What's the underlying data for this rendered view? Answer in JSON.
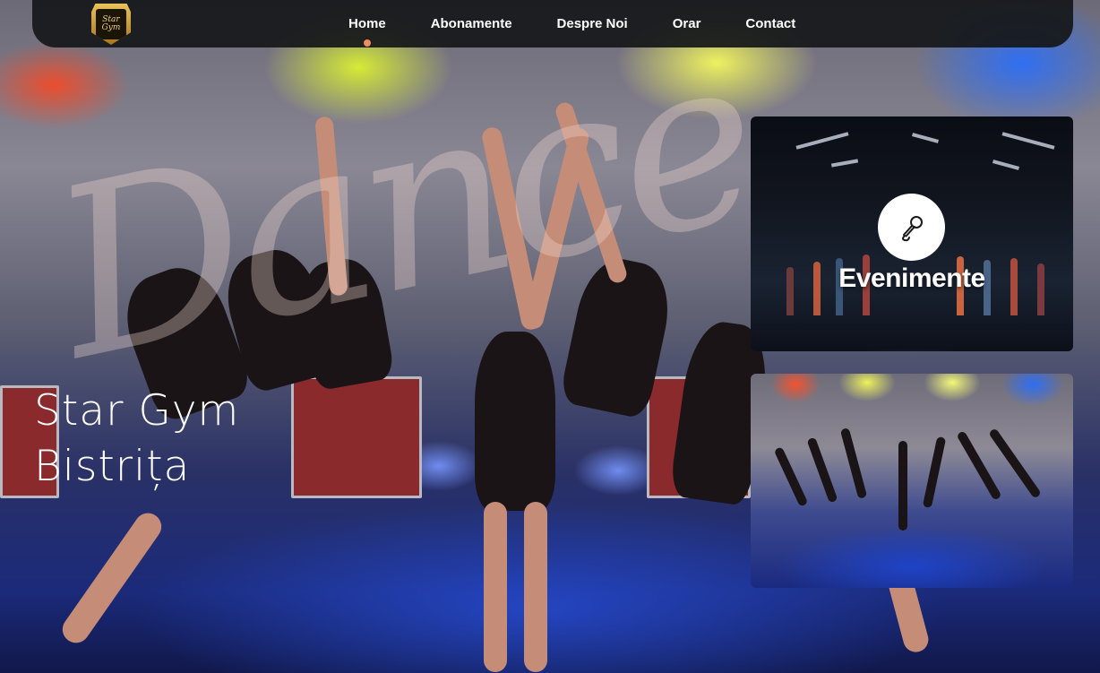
{
  "brand": {
    "logo_text_top": "Star",
    "logo_text_bottom": "Gym"
  },
  "nav": {
    "items": [
      {
        "label": "Home",
        "active": true
      },
      {
        "label": "Abonamente",
        "active": false
      },
      {
        "label": "Despre Noi",
        "active": false
      },
      {
        "label": "Orar",
        "active": false
      },
      {
        "label": "Contact",
        "active": false
      }
    ],
    "active_dot_color": "#f28a62"
  },
  "hero": {
    "watermark": "Dance",
    "title_line1": "Star Gym",
    "title_line2": "Bistrița"
  },
  "cards": {
    "events": {
      "label": "Evenimente",
      "icon": "microphone-icon"
    },
    "photo": {
      "description_icon": "dance-photo"
    }
  },
  "colors": {
    "nav_bg": "#16181a",
    "accent": "#f28a62",
    "text": "#ffffff"
  }
}
